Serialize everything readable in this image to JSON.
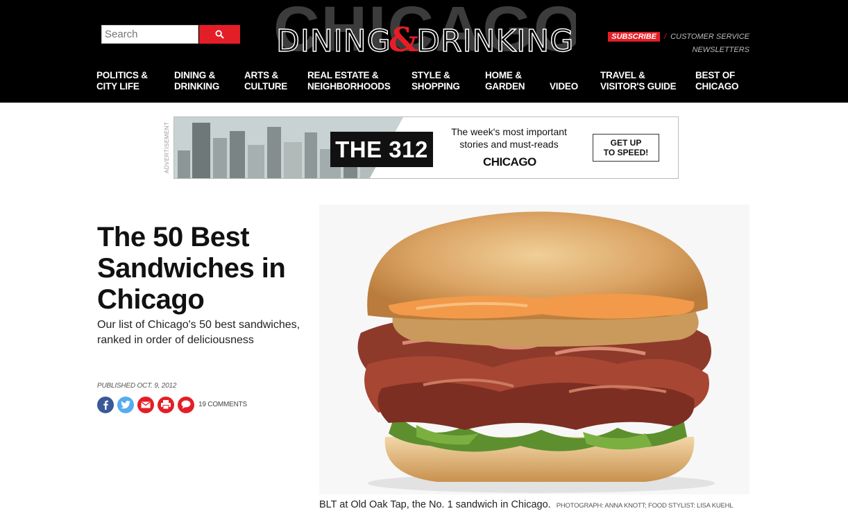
{
  "header": {
    "search": {
      "placeholder": "Search"
    },
    "logo": {
      "back_word": "CHICAGO",
      "word1": "DINING",
      "amp": "&",
      "word2": "DRINKING"
    },
    "util": {
      "subscribe": "SUBSCRIBE",
      "separator": "/",
      "customer_service": "CUSTOMER SERVICE",
      "newsletters": "NEWSLETTERS"
    },
    "nav": [
      {
        "line1": "POLITICS &",
        "line2": "CITY LIFE"
      },
      {
        "line1": "DINING &",
        "line2": "DRINKING"
      },
      {
        "line1": "ARTS &",
        "line2": "CULTURE"
      },
      {
        "line1": "REAL ESTATE &",
        "line2": "NEIGHBORHOODS"
      },
      {
        "line1": "STYLE &",
        "line2": "SHOPPING"
      },
      {
        "line1": "HOME &",
        "line2": "GARDEN"
      },
      {
        "line1": "",
        "line2": "VIDEO"
      },
      {
        "line1": "TRAVEL &",
        "line2": "VISITOR'S GUIDE"
      },
      {
        "line1": "BEST OF",
        "line2": "CHICAGO"
      }
    ]
  },
  "ad": {
    "label": "ADVERTISEMENT",
    "badge": "THE 312",
    "text_line1": "The week's most important",
    "text_line2": "stories and must-reads",
    "logo": "CHICAGO",
    "cta_line1": "GET UP",
    "cta_line2": "TO SPEED!"
  },
  "article": {
    "title": "The 50 Best Sandwiches in Chicago",
    "dek": "Our list of Chicago's 50 best sandwiches, ranked in order of deliciousness",
    "published": "PUBLISHED OCT. 9, 2012",
    "comments": "19 COMMENTS",
    "caption": "BLT at Old Oak Tap, the No. 1 sandwich in Chicago.",
    "credit": "PHOTOGRAPH: ANNA KNOTT; FOOD STYLIST: LISA KUEHL"
  },
  "icons": {
    "facebook": "facebook-icon",
    "twitter": "twitter-icon",
    "email": "email-icon",
    "print": "print-icon",
    "comment": "comment-icon"
  },
  "colors": {
    "brand_red": "#e41e26",
    "facebook_blue": "#3b5998",
    "twitter_blue": "#55acee",
    "header_bg": "#000000"
  }
}
